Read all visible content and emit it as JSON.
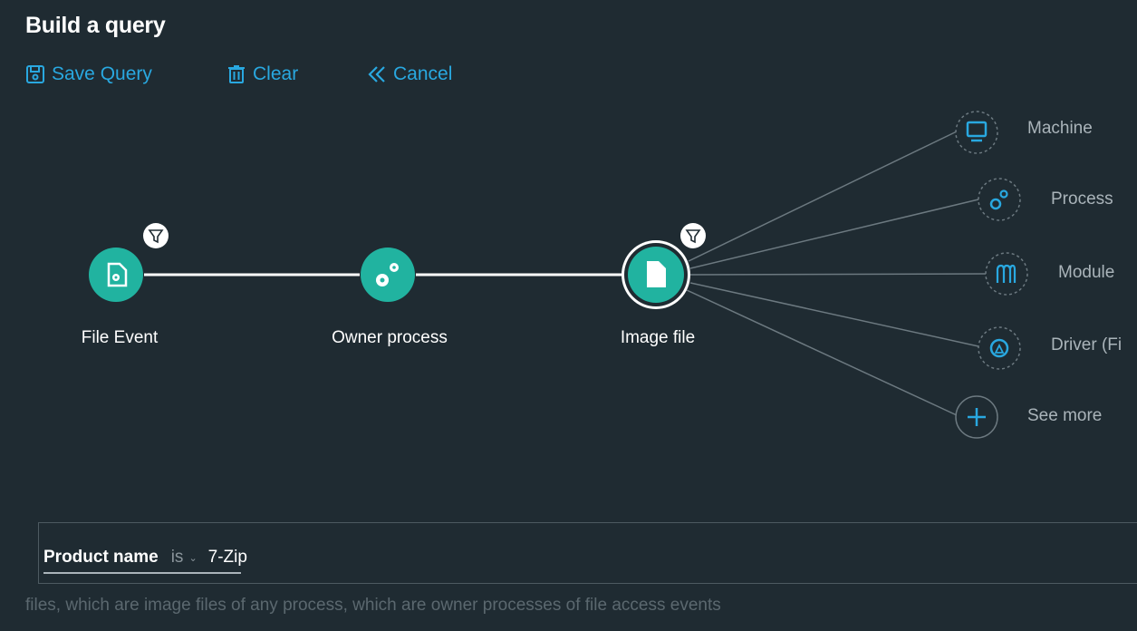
{
  "title": "Build a query",
  "toolbar": {
    "save_label": "Save Query",
    "clear_label": "Clear",
    "cancel_label": "Cancel"
  },
  "nodes": {
    "file_event": "File Event",
    "owner_process": "Owner process",
    "image_file": "Image file"
  },
  "related": {
    "machine": "Machine",
    "process": "Process",
    "module": "Module",
    "driver": "Driver (Fi",
    "see_more": "See more"
  },
  "query": {
    "field": "Product name",
    "operator": "is",
    "value": "7-Zip",
    "summary": "files, which are image files of any process, which are owner processes of file access events"
  },
  "colors": {
    "background": "#1f2b32",
    "accent": "#29a8e0",
    "node_fill": "#21b3a0"
  }
}
